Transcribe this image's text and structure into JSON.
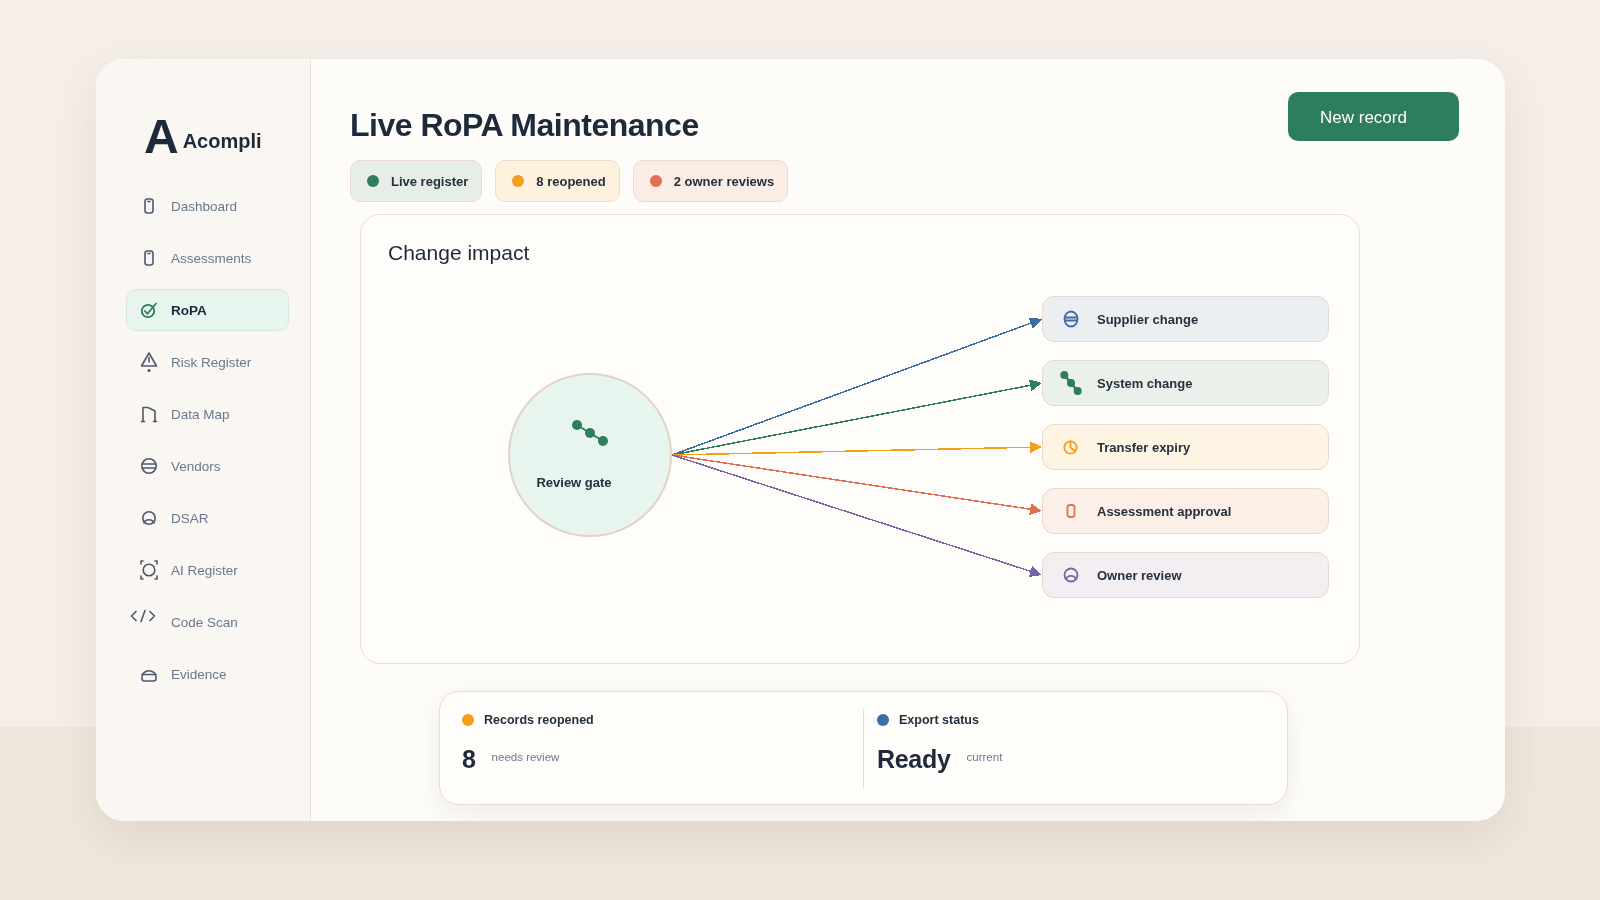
{
  "sidebar": {
    "logo_mark": "A",
    "brand": "Acompli",
    "items": [
      {
        "label": "Dashboard",
        "selected": false
      },
      {
        "label": "Assessments",
        "selected": false
      },
      {
        "label": "RoPA",
        "selected": true
      },
      {
        "label": "Risk Register",
        "selected": false
      },
      {
        "label": "Data Map",
        "selected": false
      },
      {
        "label": "Vendors",
        "selected": false
      },
      {
        "label": "DSAR",
        "selected": false
      },
      {
        "label": "AI Register",
        "selected": false
      },
      {
        "label": "Code Scan",
        "selected": false
      },
      {
        "label": "Evidence",
        "selected": false
      }
    ]
  },
  "header": {
    "title": "Live RoPA Maintenance",
    "button": "New record",
    "pills": [
      {
        "label": "Live register",
        "color": "#2e7d5f"
      },
      {
        "label": "8 reopened",
        "color": "#f59e1b"
      },
      {
        "label": "2 owner reviews",
        "color": "#e07050"
      }
    ]
  },
  "impact": {
    "title": "Change impact",
    "hub": {
      "label": "Review gate"
    },
    "targets": [
      {
        "label": "Supplier change",
        "color": "#3a6ea5"
      },
      {
        "label": "System change",
        "color": "#2e7d5f"
      },
      {
        "label": "Transfer expiry",
        "color": "#f59e1b"
      },
      {
        "label": "Assessment approval",
        "color": "#e07050"
      },
      {
        "label": "Owner review",
        "color": "#7a64a8"
      }
    ]
  },
  "stats": [
    {
      "label": "Records reopened",
      "color": "#f59e1b",
      "value": "8",
      "note": "needs review"
    },
    {
      "label": "Export status",
      "color": "#3a6ea5",
      "value": "Ready",
      "note": "current"
    }
  ]
}
